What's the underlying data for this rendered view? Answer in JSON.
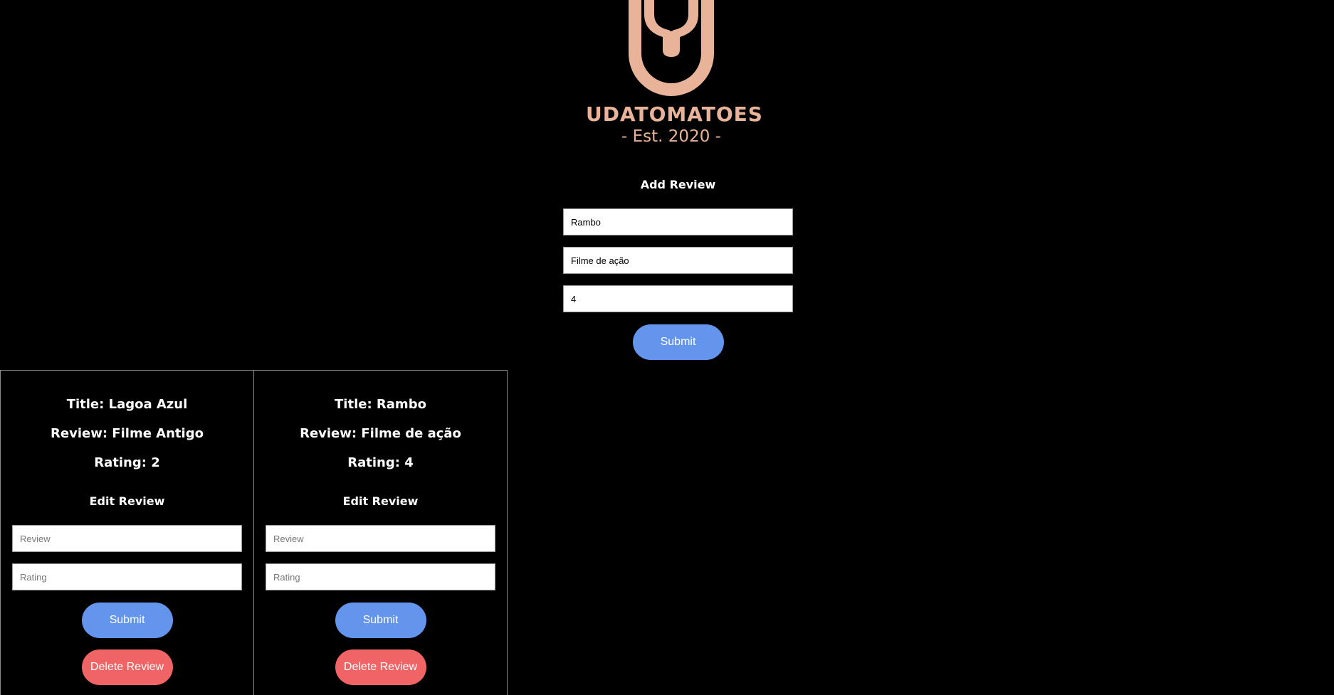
{
  "logo": {
    "brand": "UDATOMATOES",
    "est": "- Est. 2020 -",
    "color": "#e8b399"
  },
  "add_review": {
    "heading": "Add Review",
    "title_value": "Rambo",
    "review_value": "Filme de ação",
    "rating_value": "4",
    "submit_label": "Submit"
  },
  "reviews": [
    {
      "title_line": "Title: Lagoa Azul",
      "review_line": "Review: Filme Antigo",
      "rating_line": "Rating: 2",
      "edit_heading": "Edit Review",
      "review_placeholder": "Review",
      "rating_placeholder": "Rating",
      "submit_label": "Submit",
      "delete_label": "Delete Review"
    },
    {
      "title_line": "Title: Rambo",
      "review_line": "Review: Filme de ação",
      "rating_line": "Rating: 4",
      "edit_heading": "Edit Review",
      "review_placeholder": "Review",
      "rating_placeholder": "Rating",
      "submit_label": "Submit",
      "delete_label": "Delete Review"
    }
  ],
  "colors": {
    "background": "#000000",
    "submit": "#6495ed",
    "delete": "#f06466",
    "accent": "#e8b399"
  }
}
